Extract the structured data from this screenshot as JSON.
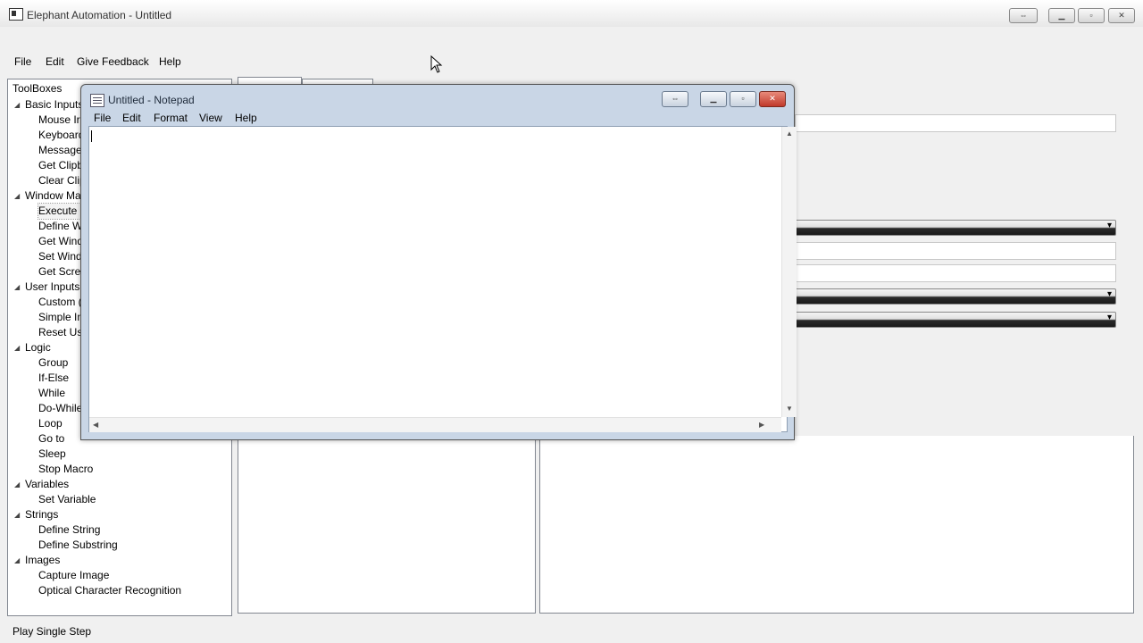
{
  "window": {
    "title": "Elephant Automation - Untitled"
  },
  "menu": [
    "File",
    "Edit",
    "Give Feedback",
    "Help"
  ],
  "toolbar": {
    "icons": [
      "new-macro-icon",
      "open-icon",
      "save-icon",
      "save-as-icon",
      "save-all-icon",
      "close-icon",
      "close-all-icon",
      "cut-icon",
      "copy-icon",
      "paste-icon",
      "stop-record-icon",
      "rewind-icon",
      "stop-icon",
      "play-icon",
      "play-step-icon"
    ]
  },
  "toolbox": {
    "header": "ToolBoxes",
    "groups": [
      {
        "label": "Basic Inputs",
        "items": [
          "Mouse Ir",
          "Keyboard",
          "Message",
          "Get Clipb",
          "Clear Clip"
        ]
      },
      {
        "label": "Window Ma",
        "items": [
          "Execute C",
          "Define W",
          "Get Wind",
          "Set Wind",
          "Get Scree"
        ]
      },
      {
        "label": "User Inputs",
        "items": [
          "Custom (",
          "Simple In",
          "Reset Use"
        ]
      },
      {
        "label": "Logic",
        "items": [
          "Group",
          "If-Else",
          "While",
          "Do-While",
          "Loop",
          "Go to",
          "Sleep",
          "Stop Macro"
        ]
      },
      {
        "label": "Variables",
        "items": [
          "Set Variable"
        ]
      },
      {
        "label": "Strings",
        "items": [
          "Define String",
          "Define Substring"
        ]
      },
      {
        "label": "Images",
        "items": [
          "Capture Image",
          "Optical Character Recognition"
        ]
      }
    ]
  },
  "status": {
    "text": "Play Single Step"
  },
  "notepad": {
    "title": "Untitled - Notepad",
    "menu": [
      "File",
      "Edit",
      "Format",
      "View",
      "Help"
    ],
    "content": ""
  }
}
